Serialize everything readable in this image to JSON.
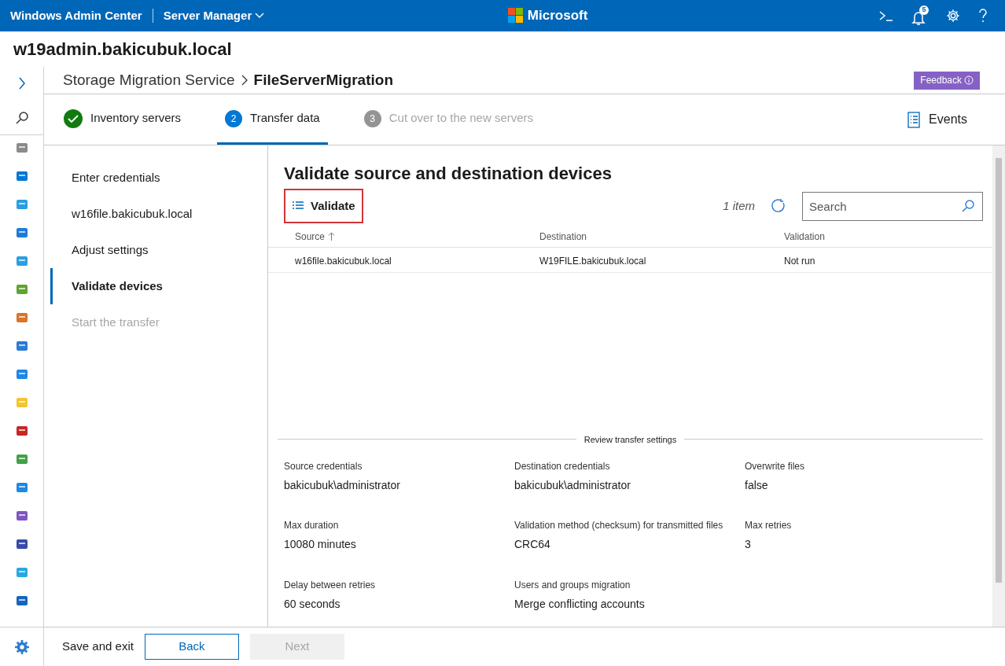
{
  "top_bar": {
    "app_title": "Windows Admin Center",
    "tool_menu": "Server Manager",
    "brand": "Microsoft",
    "notification_count": "5"
  },
  "server_name": "w19admin.bakicubuk.local",
  "breadcrumb": {
    "parent": "Storage Migration Service",
    "current": "FileServerMigration"
  },
  "feedback_button": "Feedback",
  "steps": [
    {
      "label": "Inventory servers",
      "kind": "complete",
      "selected": false
    },
    {
      "number": "2",
      "label": "Transfer data",
      "kind": "current",
      "selected": true
    },
    {
      "number": "3",
      "label": "Cut over to the new servers",
      "kind": "pending",
      "selected": false
    }
  ],
  "events_button": "Events",
  "substeps": [
    {
      "label": "Enter credentials",
      "selected": false,
      "disabled": false
    },
    {
      "label": "w16file.bakicubuk.local",
      "selected": false,
      "disabled": false
    },
    {
      "label": "Adjust settings",
      "selected": false,
      "disabled": false
    },
    {
      "label": "Validate devices",
      "selected": true,
      "disabled": false
    },
    {
      "label": "Start the transfer",
      "selected": false,
      "disabled": true
    }
  ],
  "content": {
    "title": "Validate source and destination devices",
    "validate_button": "Validate",
    "item_count": "1 item",
    "search": {
      "placeholder": "Search"
    },
    "table": {
      "columns": [
        "Source",
        "Destination",
        "Validation"
      ],
      "rows": [
        [
          "w16file.bakicubuk.local",
          "W19FILE.bakicubuk.local",
          "Not run"
        ]
      ]
    },
    "review": {
      "heading": "Review transfer settings",
      "settings": [
        {
          "label": "Source credentials",
          "value": "bakicubuk\\administrator"
        },
        {
          "label": "Destination credentials",
          "value": "bakicubuk\\administrator"
        },
        {
          "label": "Overwrite files",
          "value": "false"
        },
        {
          "label": "Max duration",
          "value": "10080 minutes"
        },
        {
          "label": "Validation method (checksum) for transmitted files",
          "value": "CRC64"
        },
        {
          "label": "Max retries",
          "value": "3"
        },
        {
          "label": "Delay between retries",
          "value": "60 seconds"
        },
        {
          "label": "Users and groups migration",
          "value": "Merge conflicting accounts"
        }
      ]
    }
  },
  "footer": {
    "save_exit": "Save and exit",
    "back": "Back",
    "next": {
      "label": "Next",
      "disabled": true
    }
  }
}
